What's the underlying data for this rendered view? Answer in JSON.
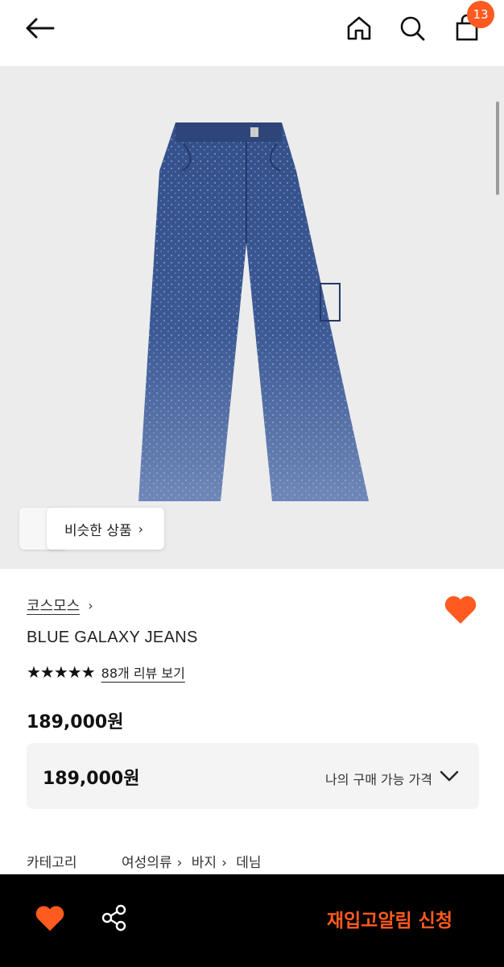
{
  "header": {
    "cart_count": "13",
    "icons": [
      "back-arrow-icon",
      "home-icon",
      "search-icon",
      "shopping-bag-icon"
    ]
  },
  "hero": {
    "similar_label": "비슷한 상품",
    "similar_chevron": "›"
  },
  "product": {
    "brand": "코스모스",
    "brand_chevron": "›",
    "title": "BLUE GALAXY JEANS",
    "stars": "★★★★★",
    "review_link": "88개 리뷰 보기",
    "price": "189,000원",
    "my_price": "189,000원",
    "my_price_label": "나의 구매 가능 가격",
    "category_label": "카테고리",
    "category_path": [
      "여성의류",
      "바지",
      "데님"
    ]
  },
  "bottom_bar": {
    "cta_label": "재입고알림 신청"
  },
  "colors": {
    "accent": "#ff5a1f",
    "bar_bg": "#000000",
    "hero_bg": "#ececec"
  }
}
